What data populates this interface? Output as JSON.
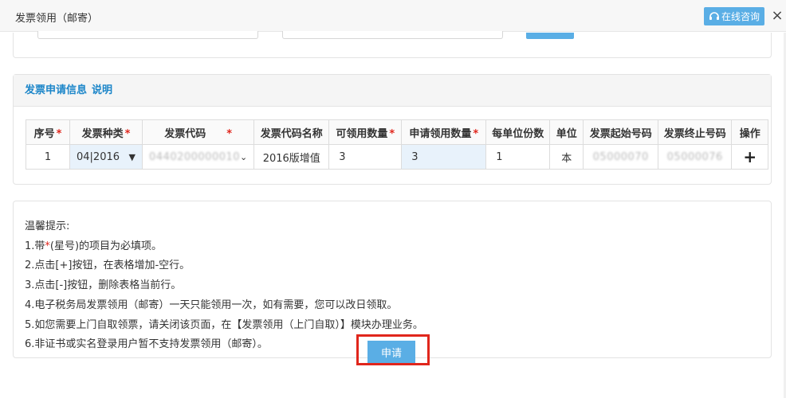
{
  "dialog": {
    "title": "发票领用（邮寄）",
    "online_consult": "在线咨询",
    "close": "×"
  },
  "apply_section": {
    "heading": "发票申请信息",
    "explain_link": "说明",
    "table": {
      "headers": [
        "序号",
        "发票种类",
        "发票代码",
        "发票代码名称",
        "可领用数量",
        "申请领用数量",
        "每单位份数",
        "单位",
        "发票起始号码",
        "发票终止号码",
        "操作"
      ],
      "row": {
        "index": "1",
        "type": "04|2016",
        "code": "0440200000010",
        "code_name": "2016版增值",
        "available_qty": "3",
        "request_qty": "3",
        "per_unit": "1",
        "unit": "本",
        "start_no": "05000070",
        "end_no": "05000076",
        "action": "+"
      }
    }
  },
  "tips": {
    "title": "温馨提示:",
    "line1_pre": "1.带",
    "line1_star": "*",
    "line1_post": "(星号)的项目为必填项。",
    "line2": "2.点击[+]按钮，在表格增加-空行。",
    "line3": "3.点击[-]按钮，删除表格当前行。",
    "line4": "4.电子税务局发票领用（邮寄）一天只能领用一次，如有需要，您可以改日领取。",
    "line5": "5.如您需要上门自取领票，请关闭该页面，在【发票领用（上门自取）】模块办理业务。",
    "line6": "6.非证书或实名登录用户暂不支持发票领用（邮寄）。"
  },
  "submit_label": "申请",
  "colors": {
    "accent": "#5aaee5",
    "heading_blue": "#1c86c9",
    "required_red": "#e0261c"
  }
}
